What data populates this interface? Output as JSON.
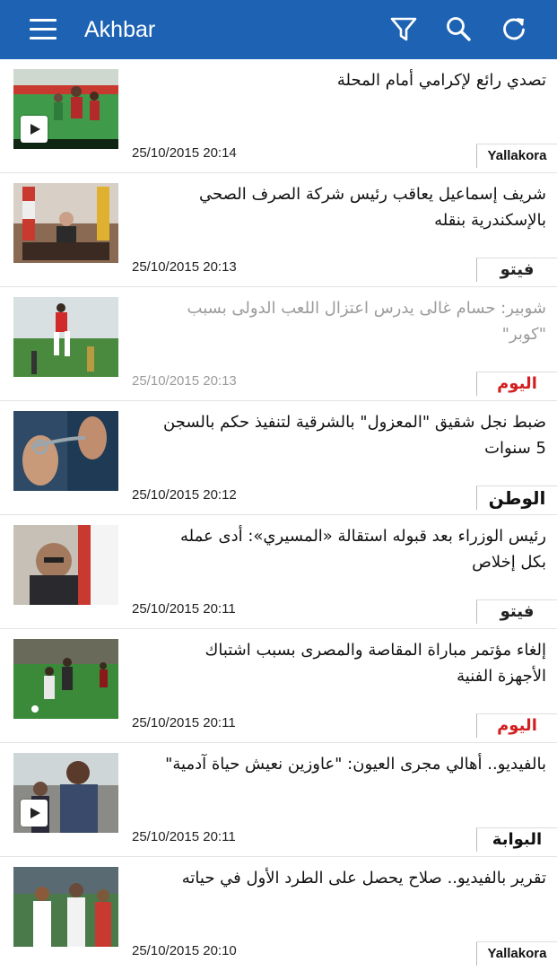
{
  "app": {
    "title": "Akhbar"
  },
  "toolbar": {
    "menu_icon": "hamburger-menu-icon",
    "filter_icon": "filter-icon",
    "search_icon": "search-icon",
    "refresh_icon": "refresh-icon"
  },
  "colors": {
    "appbar": "#1e63b3",
    "read_text": "#9b9b9b"
  },
  "articles": [
    {
      "headline": "تصدي رائع لإكرامي أمام المحلة",
      "time": "25/10/2015 20:14",
      "source": "Yallakora",
      "video": true,
      "read": false
    },
    {
      "headline": "شريف إسماعيل يعاقب رئيس شركة الصرف الصحي بالإسكندرية بنقله",
      "time": "25/10/2015 20:13",
      "source": "فيتو",
      "video": false,
      "read": false
    },
    {
      "headline": "شوبير: حسام غالى يدرس اعتزال اللعب الدولى بسبب \"كوبر\"",
      "time": "25/10/2015 20:13",
      "source": "اليوم السابع",
      "video": false,
      "read": true
    },
    {
      "headline": "ضبط نجل شقيق \"المعزول\" بالشرقية لتنفيذ حكم بالسجن 5 سنوات",
      "time": "25/10/2015 20:12",
      "source": "الوطن",
      "video": false,
      "read": false
    },
    {
      "headline": "رئيس الوزراء بعد قبوله استقالة «المسيري»: أدى عمله بكل إخلاص",
      "time": "25/10/2015 20:11",
      "source": "فيتو",
      "video": false,
      "read": false
    },
    {
      "headline": "إلغاء مؤتمر مباراة المقاصة والمصرى بسبب اشتباك الأجهزة الفنية",
      "time": "25/10/2015 20:11",
      "source": "اليوم السابع",
      "video": false,
      "read": false
    },
    {
      "headline": "بالفيديو.. أهالي مجرى العيون: \"عاوزين نعيش حياة آدمية\"",
      "time": "25/10/2015 20:11",
      "source": "البوابة",
      "video": true,
      "read": false
    },
    {
      "headline": "تقرير بالفيديو.. صلاح يحصل على الطرد الأول في حياته",
      "time": "25/10/2015 20:10",
      "source": "Yallakora",
      "video": false,
      "read": false
    }
  ]
}
